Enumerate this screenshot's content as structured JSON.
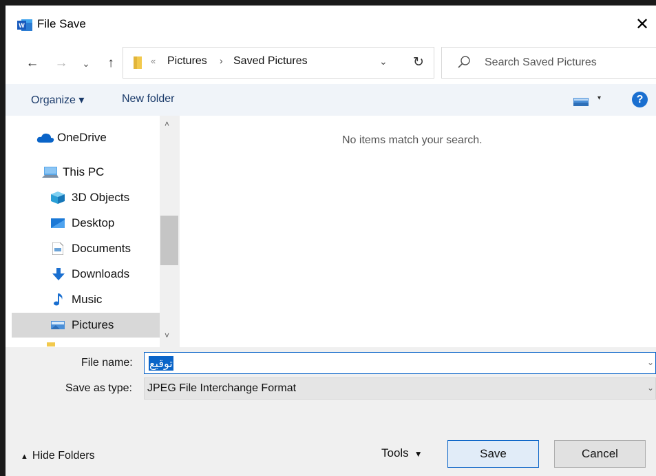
{
  "window": {
    "title": "File Save",
    "close_glyph": "✕",
    "app_icon": "word-icon"
  },
  "nav": {
    "back_glyph": "←",
    "forward_glyph": "→",
    "recent_glyph": "⌄",
    "up_glyph": "↑",
    "breadcrumb_more": "«",
    "breadcrumb": [
      "Pictures",
      "Saved Pictures"
    ],
    "breadcrumb_sep": "›",
    "dropdown_glyph": "⌄",
    "refresh_glyph": "↻",
    "search_placeholder": "Search Saved Pictures"
  },
  "toolbar": {
    "organize_label": "Organize ▾",
    "new_folder_label": "New folder",
    "view_dd_glyph": "▾",
    "help_glyph": "?"
  },
  "tree": {
    "items": [
      {
        "label": "OneDrive",
        "icon": "cloud-icon"
      },
      {
        "label": "This PC",
        "icon": "computer-icon"
      },
      {
        "label": "3D Objects",
        "icon": "cube-icon"
      },
      {
        "label": "Desktop",
        "icon": "desktop-icon"
      },
      {
        "label": "Documents",
        "icon": "document-icon"
      },
      {
        "label": "Downloads",
        "icon": "download-icon"
      },
      {
        "label": "Music",
        "icon": "music-note-icon"
      },
      {
        "label": "Pictures",
        "icon": "picture-icon",
        "selected": true
      }
    ],
    "scroll_up_glyph": "˄",
    "scroll_down_glyph": "˅"
  },
  "content": {
    "empty_message": "No items match your search."
  },
  "form": {
    "file_name_label": "File name:",
    "file_name_value": "توقيع",
    "save_as_type_label": "Save as type:",
    "save_as_type_value": "JPEG File Interchange Format",
    "dd_glyph": "⌄"
  },
  "footer": {
    "hide_folders_caret": "▲",
    "hide_folders_label": "Hide Folders",
    "tools_label": "Tools",
    "tools_glyph": "▼",
    "save_label": "Save",
    "cancel_label": "Cancel"
  },
  "colors": {
    "accent": "#0a64c8",
    "selected_bg": "#d8d8d8",
    "toolbar_bg": "#f0f4f9"
  }
}
